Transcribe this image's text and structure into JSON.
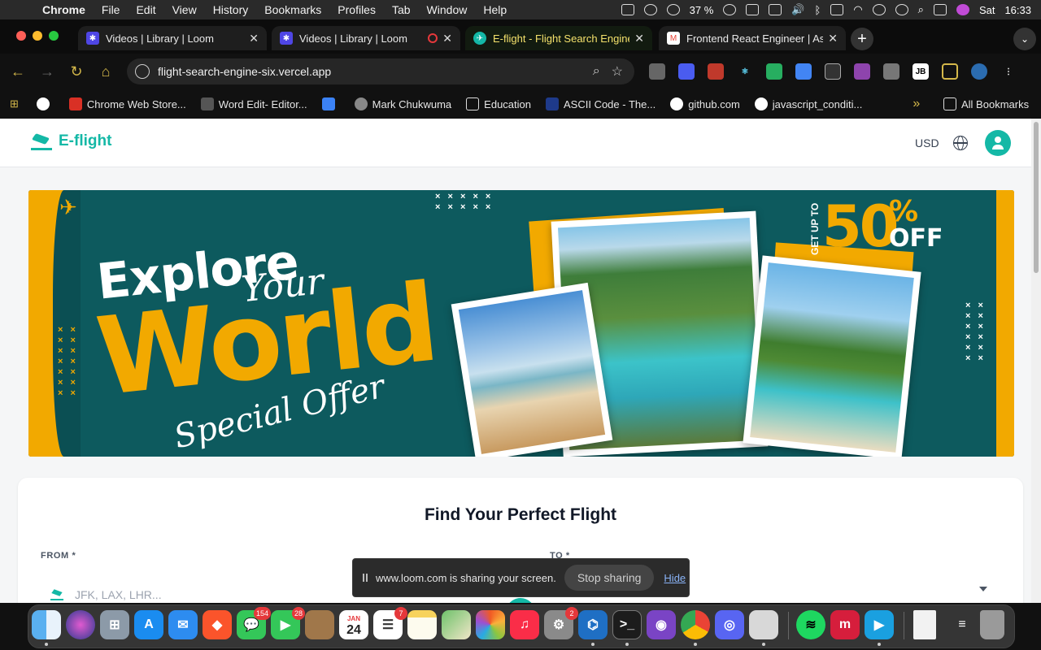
{
  "menubar": {
    "app_name": "Chrome",
    "items": [
      "File",
      "Edit",
      "View",
      "History",
      "Bookmarks",
      "Profiles",
      "Tab",
      "Window",
      "Help"
    ],
    "battery": "37 %",
    "day": "Sat",
    "time": "16:33"
  },
  "tabs": [
    {
      "title": "Videos | Library | Loom",
      "favicon_color": "#4f46e5"
    },
    {
      "title": "Videos | Library | Loom",
      "favicon_color": "#4f46e5",
      "recording": true
    },
    {
      "title": "E-flight - Flight Search Engine",
      "favicon_color": "#14b8a6",
      "active": true
    },
    {
      "title": "Frontend React Engineer | As",
      "favicon_color": "#ea4335"
    }
  ],
  "new_tab_label": "+",
  "address_bar": {
    "url": "flight-search-engine-six.vercel.app"
  },
  "bookmarks": [
    {
      "label": "Chrome Web Store...",
      "icon": "chrome-store-icon",
      "color": "#d93025"
    },
    {
      "label": "Word Edit- Editor...",
      "icon": "word-edit-icon",
      "color": "#555555"
    },
    {
      "label": "",
      "icon": "brave-icon",
      "color": "#3b82f6"
    },
    {
      "label": "Mark Chukwuma",
      "icon": "globe-icon",
      "color": "#888888"
    },
    {
      "label": "Education",
      "icon": "folder-icon",
      "color": "transparent"
    },
    {
      "label": "ASCII Code - The...",
      "icon": "ascii-icon",
      "color": "#1e3a8a"
    },
    {
      "label": "github.com",
      "icon": "github-icon",
      "color": "#ffffff"
    },
    {
      "label": "javascript_conditi...",
      "icon": "github-icon",
      "color": "#ffffff"
    }
  ],
  "bookmarks_more": "»",
  "all_bookmarks": "All Bookmarks",
  "site": {
    "brand": "E-flight",
    "currency": "USD",
    "accent": "#14b8a6"
  },
  "banner": {
    "headline_1": "Explore",
    "headline_2": "Your",
    "headline_3": "World",
    "headline_4": "Special Offer",
    "promo_prefix": "GET UP TO",
    "promo_value": "50",
    "promo_percent": "%",
    "promo_suffix": "OFF",
    "xs_top": "× × × × ×\n× × × × ×",
    "xs_left": "× ×\n× ×\n× ×\n× ×\n× ×\n× ×\n× ×",
    "xs_right": "× ×\n× ×\n× ×\n× ×\n× ×\n× ×"
  },
  "search": {
    "title": "Find Your Perfect Flight",
    "from_label": "FROM *",
    "to_label": "TO *",
    "from_placeholder": "JFK, LAX, LHR..."
  },
  "share_bar": {
    "message": "www.loom.com is sharing your screen.",
    "stop_label": "Stop sharing",
    "hide_label": "Hide"
  },
  "dock": {
    "badges": {
      "messages": "154",
      "facetime": "28",
      "reminders": "7",
      "settings": "2"
    },
    "calendar_month": "JAN",
    "calendar_day": "24"
  }
}
